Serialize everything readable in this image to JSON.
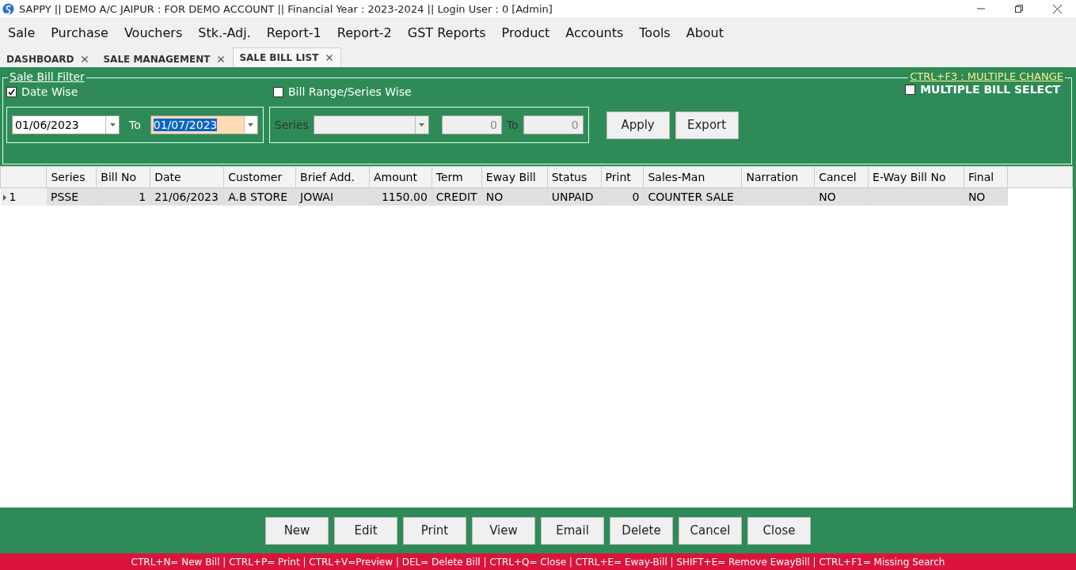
{
  "window": {
    "title": "SAPPY || DEMO A/C JAIPUR : FOR DEMO ACCOUNT || Financial Year : 2023-2024 || Login User : 0 [Admin]"
  },
  "menu": [
    "Sale",
    "Purchase",
    "Vouchers",
    "Stk.-Adj.",
    "Report-1",
    "Report-2",
    "GST Reports",
    "Product",
    "Accounts",
    "Tools",
    "About"
  ],
  "tabs": [
    {
      "label": "DASHBOARD",
      "selected": false
    },
    {
      "label": "SALE MANAGEMENT",
      "selected": false
    },
    {
      "label": "SALE BILL LIST",
      "selected": true
    }
  ],
  "filter": {
    "title": "Sale Bill Filter",
    "shortcut": "CTRL+F3 : MULTIPLE CHANGE",
    "date_wise": {
      "label": "Date Wise",
      "checked": true
    },
    "bill_range": {
      "label": "Bill Range/Series Wise",
      "checked": false
    },
    "multiple_select": {
      "label": "MULTIPLE BILL SELECT",
      "checked": false
    },
    "from_date": "01/06/2023",
    "to_label": "To",
    "to_date": "01/07/2023",
    "series_label": "Series",
    "range_from": "0",
    "range_to_label": "To",
    "range_to": "0",
    "buttons": [
      "Apply",
      "Export"
    ]
  },
  "table": {
    "columns": [
      "Series",
      "Bill No",
      "Date",
      "Customer",
      "Brief Add.",
      "Amount",
      "Term",
      "Eway Bill",
      "Status",
      "Print",
      "Sales-Man",
      "Narration",
      "Cancel",
      "E-Way Bill No",
      "Final"
    ],
    "rows": [
      {
        "row_header": "1",
        "selected": true,
        "cells": [
          "PSSE",
          "1",
          "21/06/2023",
          "A.B STORE",
          "JOWAI",
          "1150.00",
          "CREDIT",
          "NO",
          "UNPAID",
          "0",
          "COUNTER SALE",
          "",
          "NO",
          "",
          "NO"
        ]
      }
    ]
  },
  "actions": [
    "New",
    "Edit",
    "Print",
    "View",
    "Email",
    "Delete",
    "Cancel",
    "Close"
  ],
  "status_bar": "CTRL+N= New Bill | CTRL+P= Print | CTRL+V=Preview | DEL= Delete Bill | CTRL+Q= Close | CTRL+E= Eway-Bill | SHIFT+E= Remove EwayBill | CTRL+F1= Missing Search"
}
